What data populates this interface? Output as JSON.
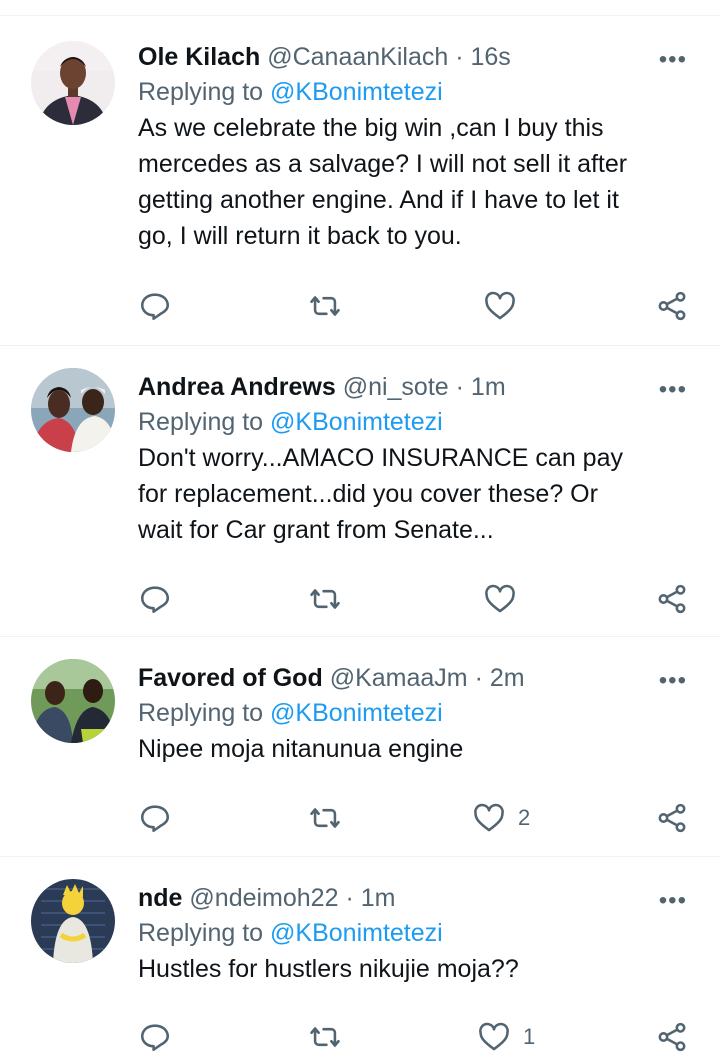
{
  "colors": {
    "link": "#1d9bf0",
    "secondary": "#536471",
    "text": "#0f1419",
    "divider": "#eff3f4"
  },
  "more_label": "•••",
  "tweets": [
    {
      "name": "Ole Kilach",
      "handle": "@CanaanKilach",
      "dot": "·",
      "time": "16s",
      "replying_prefix": "Replying to",
      "replying_to": "@KBonimtetezi",
      "text": "As we celebrate the big win ,can I buy this\nmercedes as a salvage? I will not sell it after\ngetting another engine. And if I have to let it\ngo, I will return it back to you.",
      "reply_count": "",
      "retweet_count": "",
      "like_count": ""
    },
    {
      "name": "Andrea Andrews",
      "handle": "@ni_sote",
      "dot": "·",
      "time": "1m",
      "replying_prefix": "Replying to",
      "replying_to": "@KBonimtetezi",
      "text": "Don't worry...AMACO INSURANCE can pay\nfor replacement...did you cover these? Or\nwait for Car grant from Senate...",
      "reply_count": "",
      "retweet_count": "",
      "like_count": ""
    },
    {
      "name": "Favored of God",
      "handle": "@KamaaJm",
      "dot": "·",
      "time": "2m",
      "replying_prefix": "Replying to",
      "replying_to": "@KBonimtetezi",
      "text": "Nipee moja nitanunua engine",
      "reply_count": "",
      "retweet_count": "",
      "like_count": "2"
    },
    {
      "name": "nde",
      "handle": "@ndeimoh22",
      "dot": "·",
      "time": "1m",
      "replying_prefix": "Replying to",
      "replying_to": "@KBonimtetezi",
      "text": "Hustles for hustlers nikujie moja??",
      "reply_count": "",
      "retweet_count": "",
      "like_count": "1"
    }
  ]
}
